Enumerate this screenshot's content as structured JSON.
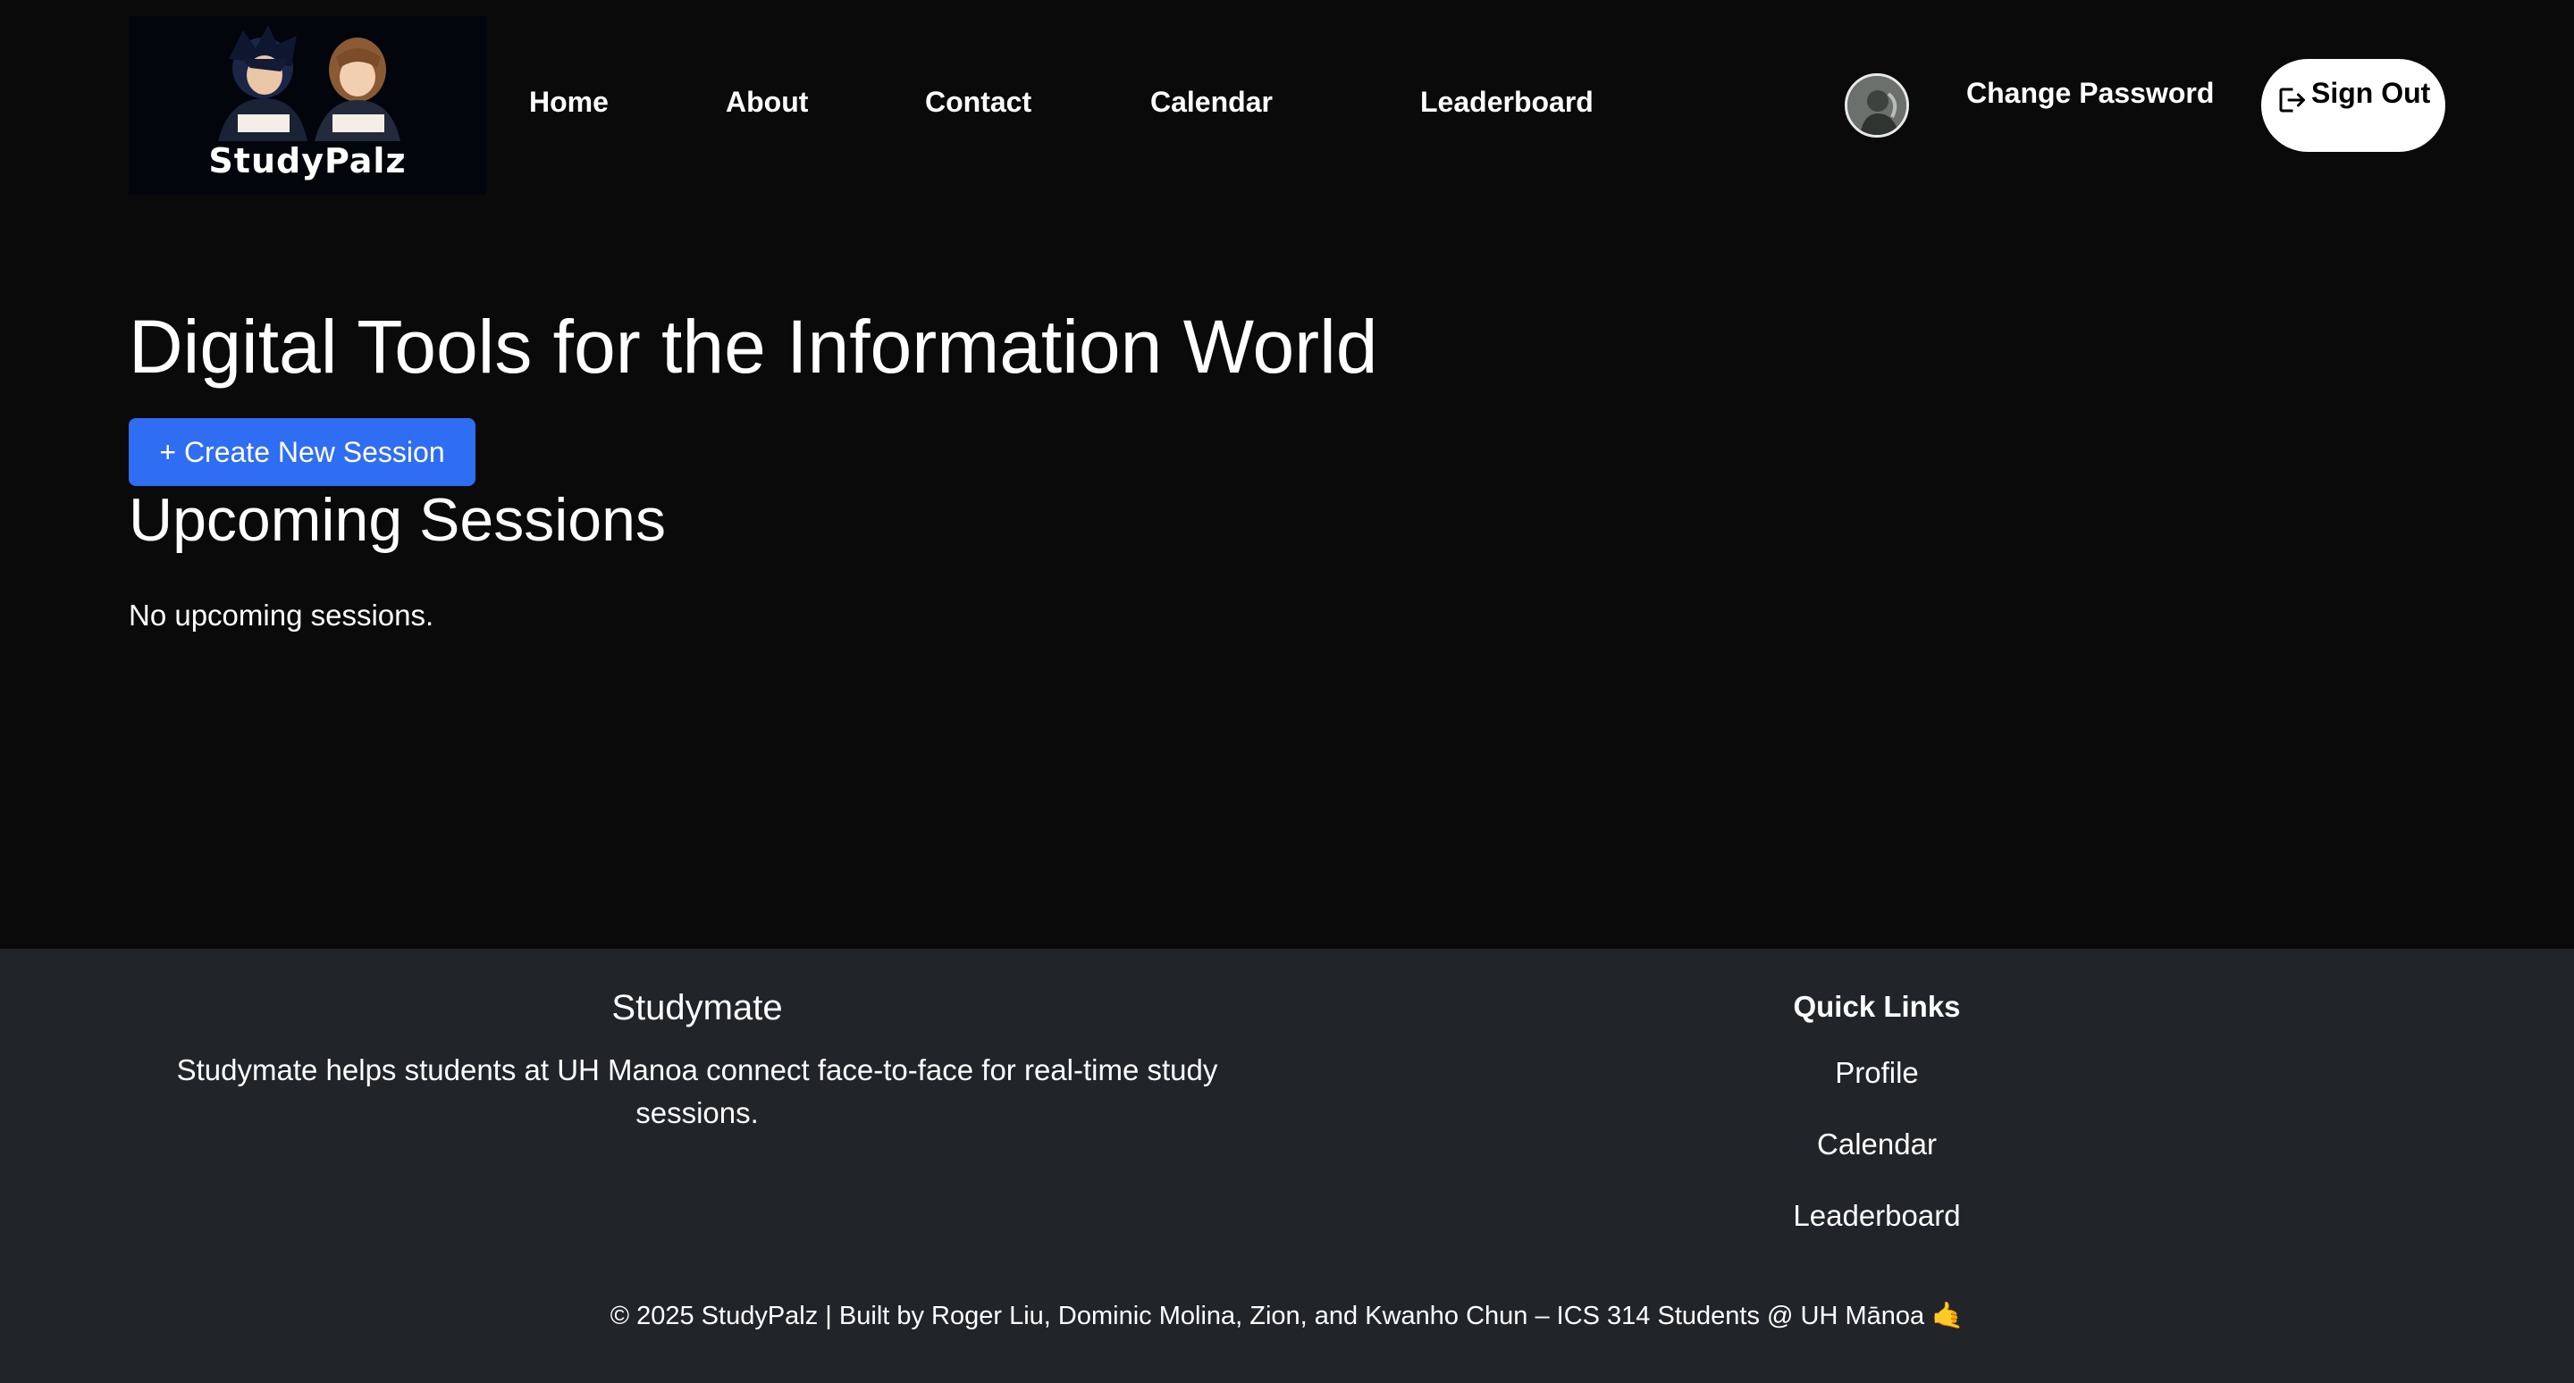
{
  "navbar": {
    "logo_text": "StudyPalz",
    "links": [
      "Home",
      "About",
      "Contact",
      "Calendar",
      "Leaderboard"
    ],
    "change_password_label": "Change Password",
    "sign_out_label": "Sign Out"
  },
  "main": {
    "title": "Digital Tools for the Information World",
    "create_button_label": "+ Create New Session",
    "section_title": "Upcoming Sessions",
    "empty_message": "No upcoming sessions."
  },
  "footer": {
    "brand": "Studymate",
    "description": "Studymate helps students at UH Manoa connect face-to-face for real-time study sessions.",
    "quick_links_title": "Quick Links",
    "quick_links": [
      "Profile",
      "Calendar",
      "Leaderboard"
    ],
    "copyright": "© 2025 StudyPalz | Built by Roger Liu, Dominic Molina, Zion, and Kwanho Chun – ICS 314 Students @ UH Mānoa 🤙"
  },
  "colors": {
    "background": "#0a0a0b",
    "footer_background": "#212429",
    "primary_button": "#2f6df3",
    "sign_out_button": "#ffffff"
  }
}
